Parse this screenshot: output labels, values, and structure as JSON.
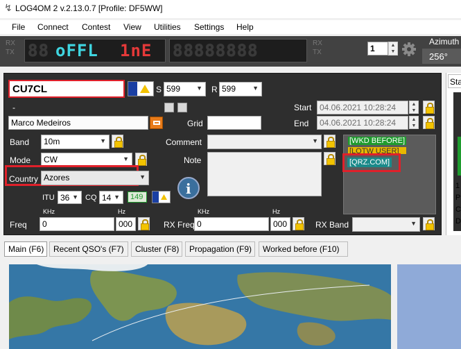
{
  "window": {
    "title": "LOG4OM 2 v.2.13.0.7 [Profile: DF5WW]"
  },
  "menu": [
    "File",
    "Connect",
    "Contest",
    "View",
    "Utilities",
    "Settings",
    "Help"
  ],
  "freq_display": {
    "rx_label": "RX",
    "tx_label": "TX",
    "status_text": "oFFL1nE",
    "dim_left": "88",
    "dim_right": "88888888",
    "rx_label_right": "RX",
    "tx_label_right": "TX"
  },
  "rotator": {
    "step": "1",
    "azimuth_label": "Azimuth",
    "azimuth_value": "256°"
  },
  "qso": {
    "callsign": "CU7CL",
    "s_label": "S",
    "s_value": "599",
    "r_label": "R",
    "r_value": "599",
    "dash": "-",
    "name": "Marco Medeiros",
    "grid_label": "Grid",
    "grid_value": "",
    "start_label": "Start",
    "start_value": "04.06.2021 10:28:24",
    "end_label": "End",
    "end_value": "04.06.2021 10:28:24",
    "band_label": "Band",
    "band_value": "10m",
    "comment_label": "Comment",
    "comment_value": "",
    "mode_label": "Mode",
    "mode_value": "CW",
    "note_label": "Note",
    "country_label": "Country",
    "country_value": "Azores",
    "itu_label": "ITU",
    "itu_value": "36",
    "cq_label": "CQ",
    "cq_value": "14",
    "dxcc_value": "149",
    "khz_label": "KHz",
    "hz_label": "Hz",
    "freq_label": "Freq",
    "freq_khz": "0",
    "freq_hz": "000",
    "rx_khz_label": "KHz",
    "rx_hz_label": "Hz",
    "rx_freq_label": "RX Freq",
    "rx_freq_khz": "0",
    "rx_freq_hz": "000",
    "rx_band_label": "RX Band",
    "rx_band_value": ""
  },
  "status_badges": {
    "wkd_before": "[WKD BEFORE]",
    "lotw_user": "[LOTW USER]",
    "qrz": "[QRZ.COM]"
  },
  "tabs": [
    "Main (F6)",
    "Recent QSO's (F7)",
    "Cluster (F8)",
    "Propagation (F9)",
    "Worked before (F10)"
  ],
  "right_panel": {
    "tab_label": "Sta",
    "letters": [
      "1",
      "P",
      "C",
      "D"
    ]
  },
  "colors": {
    "accent_red": "#e0202a",
    "led_cyan": "#3fd5e0",
    "led_red": "#e53939",
    "badge_green": "#1f9b2e",
    "badge_yellow": "#e8b800",
    "badge_teal": "#1a8a8a"
  }
}
